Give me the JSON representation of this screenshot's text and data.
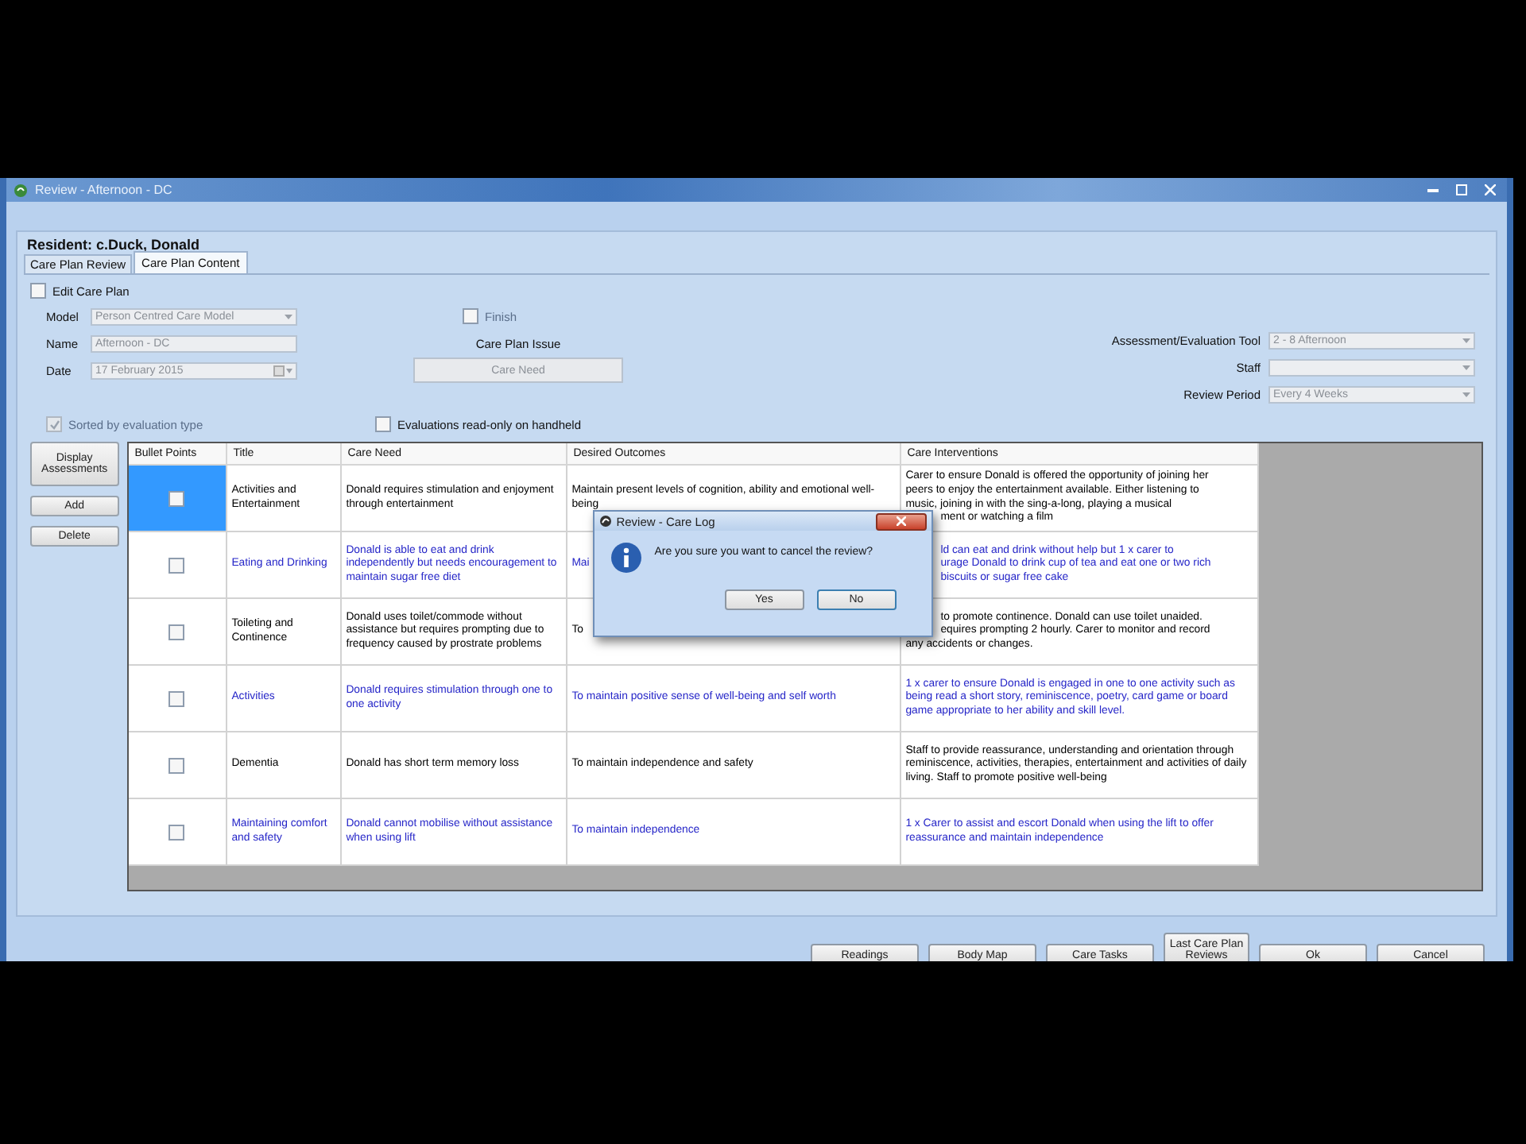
{
  "window": {
    "title": "Review - Afternoon - DC"
  },
  "resident": "Resident: c.Duck, Donald",
  "tabs": [
    {
      "label": "Care Plan Review",
      "selected": false
    },
    {
      "label": "Care Plan Content",
      "selected": true
    }
  ],
  "edit_care_plan": {
    "label": "Edit Care Plan",
    "checked": false
  },
  "fields": [
    {
      "label": "Model",
      "value": "Person Centred Care Model",
      "kind": "dropdown",
      "disabled": true
    },
    {
      "label": "Name",
      "value": "Afternoon - DC",
      "kind": "text",
      "disabled": true
    },
    {
      "label": "Date",
      "value": "17  February  2015",
      "kind": "date",
      "disabled": true
    }
  ],
  "finish": {
    "label": "Finish",
    "checked": false
  },
  "care_plan_issue": {
    "label": "Care Plan Issue",
    "button": "Care Need"
  },
  "tool_fields": [
    {
      "label": "Assessment/Evaluation Tool",
      "value": "2 - 8 Afternoon"
    },
    {
      "label": "Staff"
    },
    {
      "label": "Review Period",
      "value": "Every 4 Weeks"
    }
  ],
  "options": [
    {
      "label": "Sorted by evaluation type",
      "checked": true,
      "disabled": true
    },
    {
      "label": "Evaluations read-only on handheld",
      "checked": false,
      "disabled": false
    }
  ],
  "side_buttons": [
    "Display Assessments",
    "Add",
    "Delete"
  ],
  "table": {
    "columns": [
      "Bullet Points",
      "Title",
      "Care Need",
      "Desired Outcomes",
      "Care Interventions"
    ],
    "rows": [
      {
        "selected": true,
        "checked": false,
        "color": "#000000",
        "title": "Activities and Entertainment",
        "care_need": "Donald requires stimulation and enjoyment through entertainment",
        "desired_outcomes": "Maintain present levels of cognition, ability and emotional well-being",
        "care_interventions": {
          "lines": [
            {
              "text": "Carer to ensure Donald is offered the opportunity of joining her",
              "cut": false
            },
            {
              "text": "peers to enjoy the entertainment available.  Either listening to",
              "cut": false
            },
            {
              "text": "music, joining in with the sing-a-long, playing a musical",
              "cut": false
            },
            {
              "text": "ment or watching a film",
              "cut": true
            }
          ]
        }
      },
      {
        "selected": false,
        "checked": false,
        "color": "#2626c8",
        "title": "Eating and Drinking",
        "care_need": "Donald is able to eat and drink independently but needs encouragement to maintain sugar free diet",
        "desired_outcomes": {
          "lines": [
            {
              "text": "Mai",
              "cut": false
            }
          ]
        },
        "care_interventions": {
          "lines": [
            {
              "text": "ld can eat and drink without help but 1 x carer to",
              "cut": true
            },
            {
              "text": "urage Donald to drink cup of tea and eat one or two rich",
              "cut": true
            },
            {
              "text": "biscuits or sugar free cake",
              "cut": true
            }
          ]
        }
      },
      {
        "selected": false,
        "checked": false,
        "color": "#000000",
        "title": "Toileting and Continence",
        "care_need": "Donald uses toilet/commode without assistance but requires prompting due to frequency caused by prostrate problems",
        "desired_outcomes": {
          "lines": [
            {
              "text": "To",
              "cut": false
            }
          ]
        },
        "care_interventions": {
          "lines": [
            {
              "text": "to promote continence.  Donald can use toilet unaided.",
              "cut": true
            },
            {
              "text": "equires prompting 2 hourly.  Carer to monitor and record",
              "cut": true
            },
            {
              "text": "any accidents or changes.",
              "cut": false
            }
          ]
        }
      },
      {
        "selected": false,
        "checked": false,
        "color": "#2626c8",
        "title": "Activities",
        "care_need": "Donald requires stimulation through one to one activity",
        "desired_outcomes": "To maintain positive sense of well-being and self worth",
        "care_interventions": "1 x carer to ensure Donald is engaged in one to one activity such as being read a short story, reminiscence, poetry, card game or board game appropriate to her ability and skill level."
      },
      {
        "selected": false,
        "checked": false,
        "color": "#000000",
        "title": "Dementia",
        "care_need": "Donald has short term memory loss",
        "desired_outcomes": "To maintain independence and safety",
        "care_interventions": "Staff to provide reassurance, understanding and orientation through reminiscence, activities, therapies, entertainment and activities of daily living.  Staff to promote positive well-being"
      },
      {
        "selected": false,
        "checked": false,
        "color": "#2626c8",
        "title": "Maintaining comfort and safety",
        "care_need": "Donald cannot mobilise without assistance when using lift",
        "desired_outcomes": "To maintain independence",
        "care_interventions": "1 x Carer to assist and escort Donald when using the lift to offer reassurance and maintain independence"
      }
    ]
  },
  "dialog": {
    "title": "Review - Care Log",
    "message": "Are you sure you want to cancel the review?",
    "buttons": [
      "Yes",
      "No"
    ]
  },
  "buttons": [
    "Readings",
    "Body Map",
    "Care Tasks",
    "Last Care Plan Reviews",
    "Ok",
    "Cancel"
  ]
}
